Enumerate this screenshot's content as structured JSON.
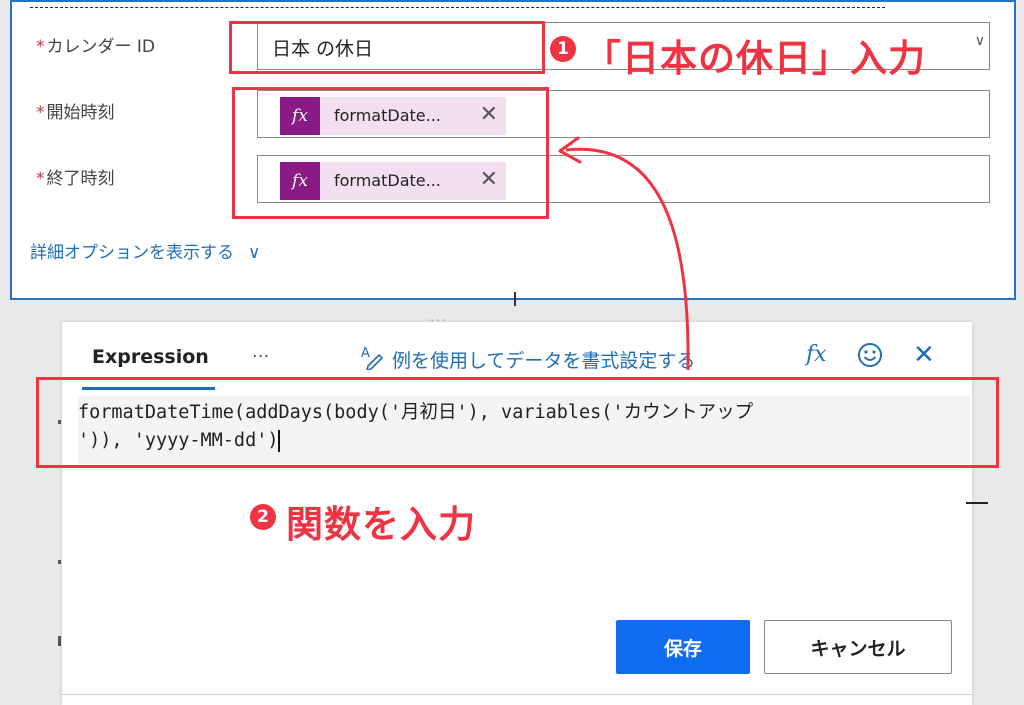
{
  "action_card": {
    "fields": [
      {
        "label": "カレンダー ID",
        "value": "日本 の休日"
      },
      {
        "label": "開始時刻",
        "token": "formatDate..."
      },
      {
        "label": "終了時刻",
        "token": "formatDate..."
      }
    ],
    "required_marker": "*",
    "advanced_options_link": "詳細オプションを表示する"
  },
  "expression_panel": {
    "tab_label": "Expression",
    "more_label": "···",
    "format_link": "例を使用してデータを書式設定する",
    "code_lines": [
      "formatDateTime(addDays(body('月初日'), variables('カウントアップ",
      "')), 'yyyy-MM-dd')"
    ],
    "save_button": "保存",
    "cancel_button": "キャンセル"
  },
  "annotations": {
    "step1_number": "1",
    "step1_text": "「日本の休日」入力",
    "step2_number": "2",
    "step2_text": "関数を入力",
    "highlight_color": "#ee3443"
  },
  "colors": {
    "accent": "#1f6fb7",
    "save_button": "#0f6cf0",
    "token_fx": "#8a1a86",
    "token_bg": "#f2dff0"
  },
  "icons": [
    "fx-icon",
    "close-icon",
    "smile-icon",
    "format-icon",
    "chevron-down-icon"
  ]
}
